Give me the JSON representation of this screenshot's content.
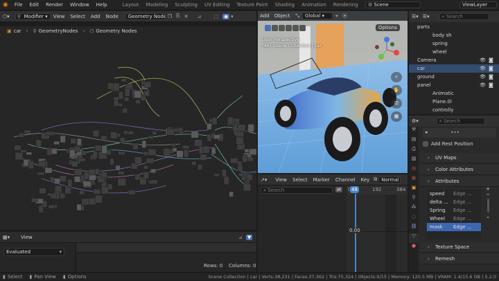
{
  "menu": [
    "File",
    "Edit",
    "Render",
    "Window",
    "Help"
  ],
  "workspaces": [
    "Layout",
    "Modeling",
    "Sculpting",
    "UV Editing",
    "Texture Paint",
    "Shading",
    "Animation",
    "Rendering",
    "Compo"
  ],
  "active_workspace": "Geometry Nodes",
  "scene": "Scene",
  "view_layer": "ViewLayer",
  "node_editor": {
    "editor_type": "Modifier",
    "menus": [
      "View",
      "Select",
      "Add",
      "Node"
    ],
    "tree_name": "Geometry Nodes",
    "breadcrumb": [
      "car",
      "GeometryNodes",
      "Geometry Nodes"
    ]
  },
  "viewport": {
    "menus": [
      "Add",
      "Object"
    ],
    "orientation": "Global",
    "options": "Options",
    "overlay_title": "User Perspective",
    "overlay_sub": "(48) Scene Collection | car"
  },
  "spreadsheet": {
    "menu": "View",
    "mode": "Evaluated",
    "rows": "Rows: 0",
    "columns": "Columns: 0"
  },
  "timeline": {
    "menus": [
      "View",
      "Select",
      "Marker",
      "Channel",
      "Key"
    ],
    "mode": "Normal",
    "search_placeholder": "Search",
    "current_frame": "48",
    "frame_labels": [
      "0",
      "192",
      "384"
    ],
    "value_label": "0.00"
  },
  "outliner": {
    "search_placeholder": "Search",
    "items": [
      {
        "name": "parts",
        "indent": 0
      },
      {
        "name": "body sh",
        "indent": 1
      },
      {
        "name": "spring",
        "indent": 1
      },
      {
        "name": "wheel",
        "indent": 1
      },
      {
        "name": "Camera",
        "indent": 0
      },
      {
        "name": "car",
        "indent": 0
      },
      {
        "name": "ground",
        "indent": 0
      },
      {
        "name": "panel",
        "indent": 0
      },
      {
        "name": "Animatic",
        "indent": 1
      },
      {
        "name": "Plane.0l",
        "indent": 1
      },
      {
        "name": "controlly",
        "indent": 1
      }
    ]
  },
  "properties": {
    "search_placeholder": "Search",
    "add_rest_position": "Add Rest Position",
    "panels_top": [
      "UV Maps",
      "Color Attributes",
      "Attributes"
    ],
    "attributes": [
      {
        "name": "speed",
        "domain": "Edge ..."
      },
      {
        "name": "delta ...",
        "domain": "Edge ..."
      },
      {
        "name": "Spring",
        "domain": "Edge ..."
      },
      {
        "name": "Wheel",
        "domain": "Edge ..."
      },
      {
        "name": "mask",
        "domain": "Edge ..."
      }
    ],
    "panels_bottom": [
      "Texture Space",
      "Remesh"
    ]
  },
  "status": {
    "left": [
      "Select",
      "Pan View",
      "Options"
    ],
    "right": "Scene Collection | car | Verts:38,231 | Faces:37,362 | Tris:75,324 | Objects:0/15 | Memory: 120.5 MB | VRAM: 1.4/15.6 GB | 5.2.0"
  },
  "colors": {
    "accent": "#4772b3",
    "selection": "#3d67b0",
    "frame": "#4a86c8"
  }
}
